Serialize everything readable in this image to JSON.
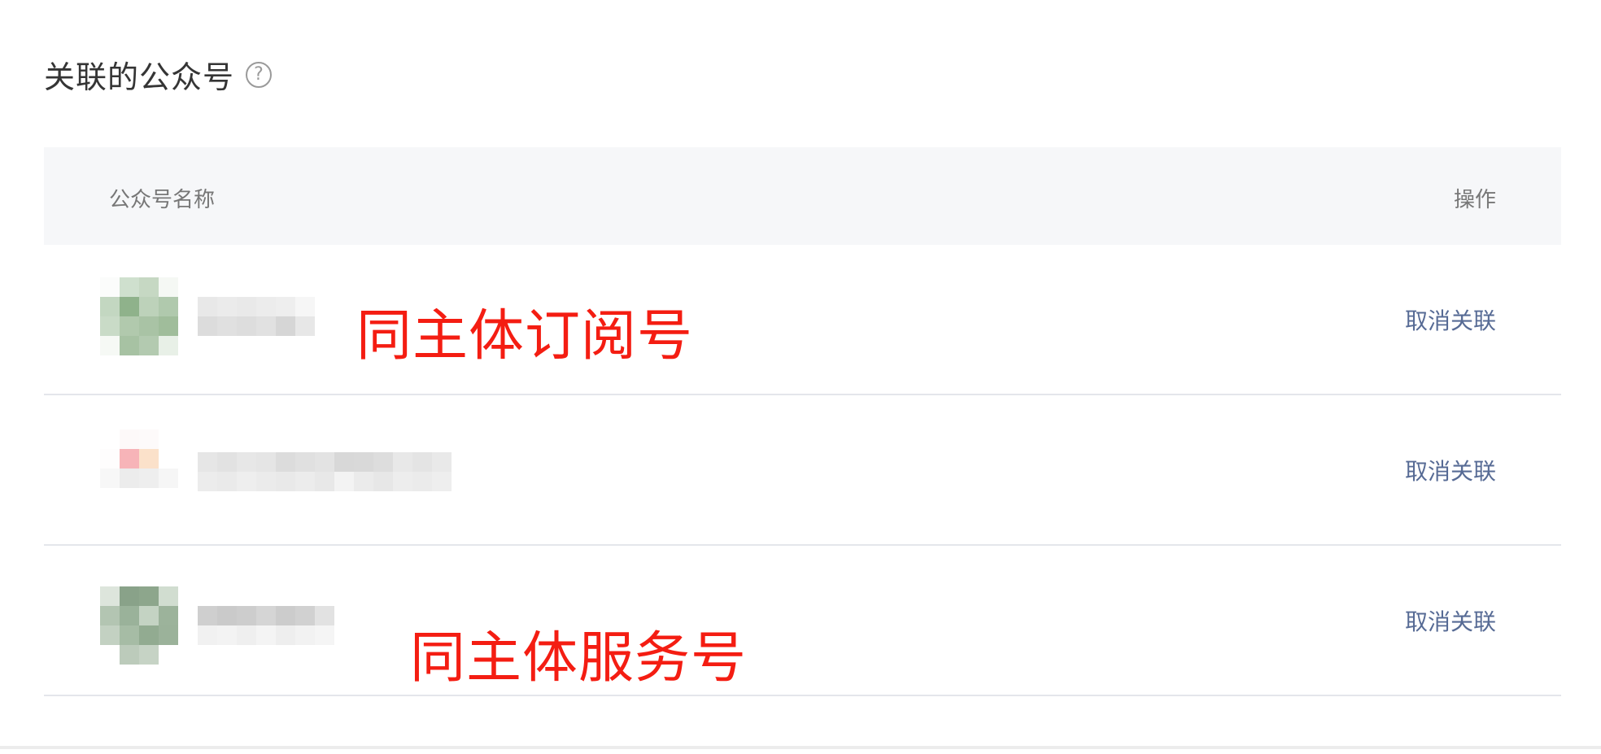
{
  "section": {
    "title": "关联的公众号",
    "help_icon": "question-circle-icon",
    "help_glyph": "?"
  },
  "table": {
    "headers": {
      "name": "公众号名称",
      "action": "操作"
    },
    "rows": [
      {
        "action_label": "取消关联",
        "annotation": "同主体订阅号"
      },
      {
        "action_label": "取消关联",
        "annotation": ""
      },
      {
        "action_label": "取消关联",
        "annotation": "同主体服务号"
      }
    ]
  },
  "colors": {
    "link": "#576b95",
    "annotation": "#f41d12",
    "header_bg": "#f6f7f9"
  }
}
